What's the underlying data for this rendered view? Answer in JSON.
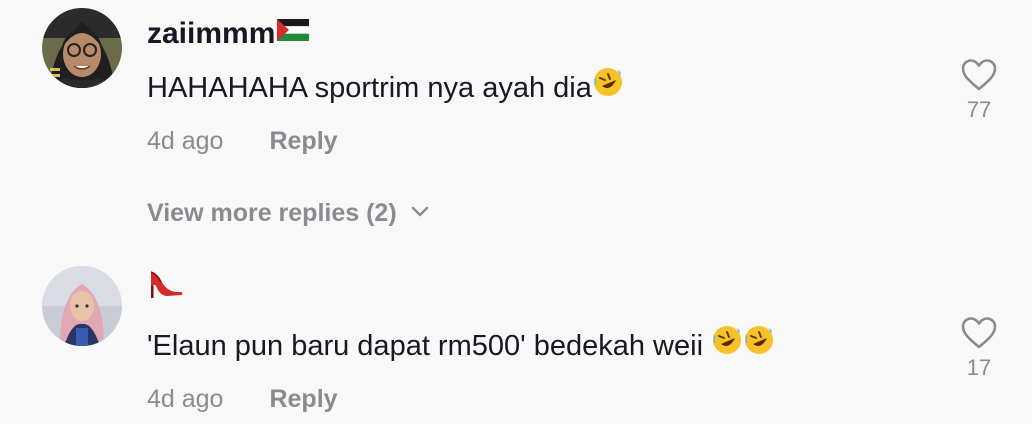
{
  "comments": [
    {
      "username": "zaiimmm",
      "username_flag_icon": "palestine-flag-icon",
      "text": "HAHAHAHA sportrim nya ayah dia",
      "text_emoji_icons": [
        "rolling-laughing-emoji-icon"
      ],
      "time": "4d ago",
      "reply_label": "Reply",
      "like_count": "77",
      "view_more_label": "View more replies (2)"
    },
    {
      "username_emoji_icon": "high-heel-shoe-icon",
      "text": "'Elaun pun baru dapat rm500' bedekah weii ",
      "text_emoji_icons": [
        "rolling-laughing-emoji-icon",
        "rolling-laughing-emoji-icon"
      ],
      "time": "4d ago",
      "reply_label": "Reply",
      "like_count": "17"
    }
  ],
  "colors": {
    "background": "#f8f8f8",
    "primary_text": "#161823",
    "secondary_text": "#8a8b91"
  }
}
